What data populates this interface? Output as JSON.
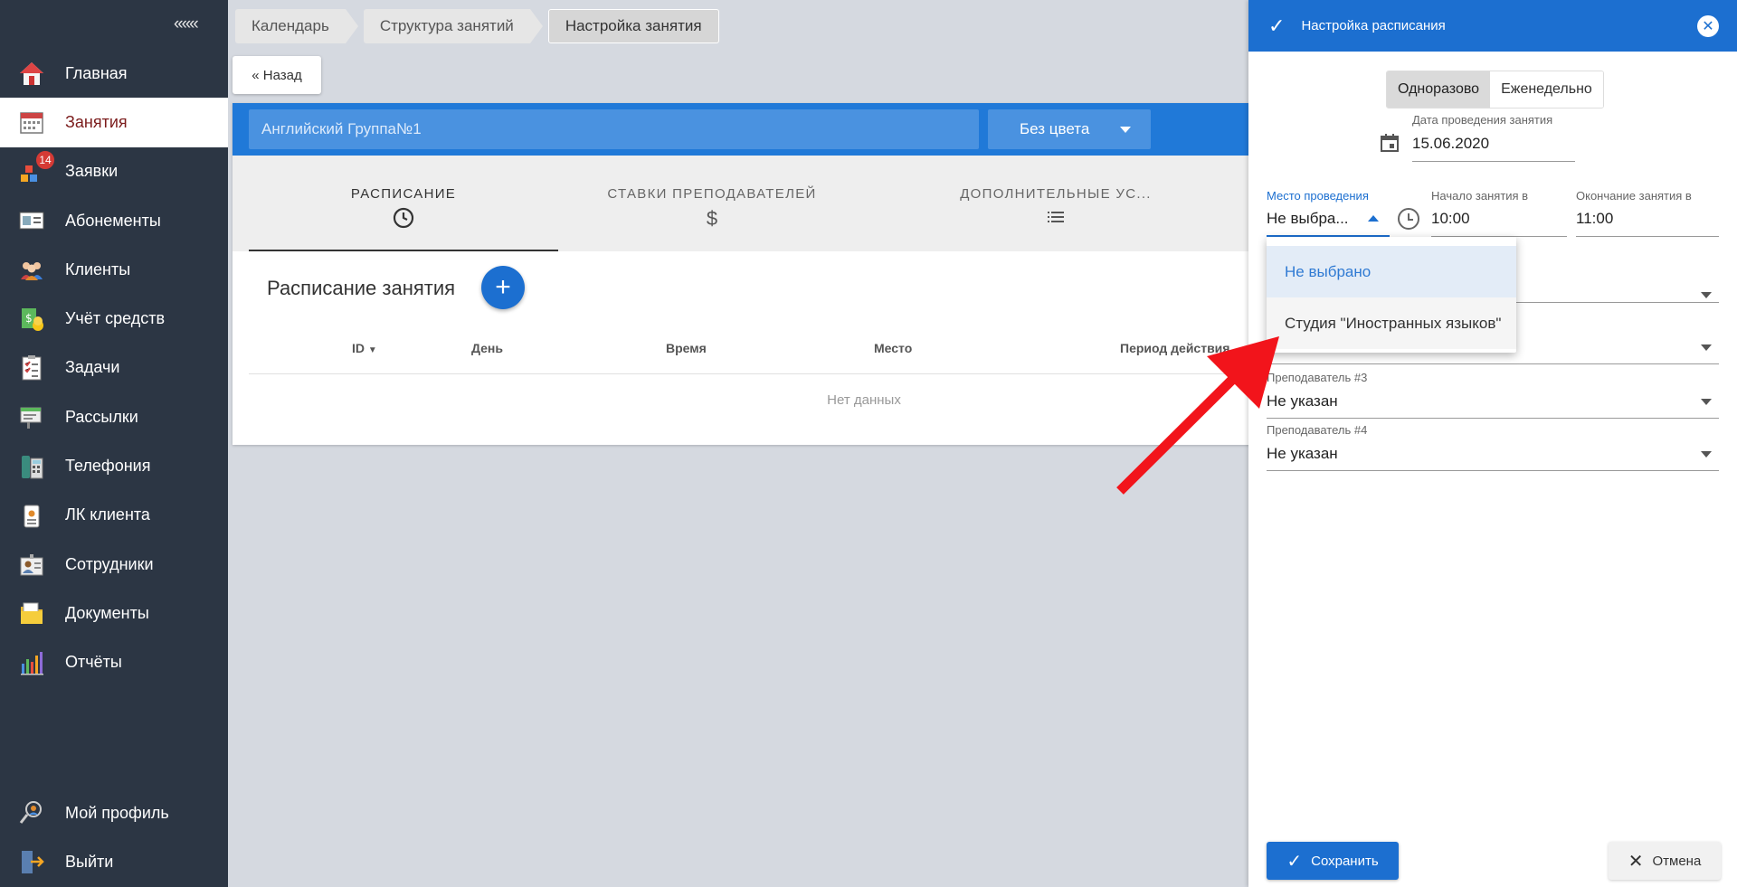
{
  "sidebar": {
    "collapse_label": "«««",
    "items": [
      {
        "label": "Главная",
        "icon": "home-icon"
      },
      {
        "label": "Занятия",
        "icon": "calendar-icon"
      },
      {
        "label": "Заявки",
        "icon": "requests-icon",
        "badge": "14"
      },
      {
        "label": "Абонементы",
        "icon": "membership-card-icon"
      },
      {
        "label": "Клиенты",
        "icon": "clients-icon"
      },
      {
        "label": "Учёт средств",
        "icon": "money-icon"
      },
      {
        "label": "Задачи",
        "icon": "tasks-icon"
      },
      {
        "label": "Рассылки",
        "icon": "mailing-icon"
      },
      {
        "label": "Телефония",
        "icon": "phone-icon"
      },
      {
        "label": "ЛК клиента",
        "icon": "client-cabinet-icon"
      },
      {
        "label": "Сотрудники",
        "icon": "staff-icon"
      },
      {
        "label": "Документы",
        "icon": "documents-icon"
      },
      {
        "label": "Отчёты",
        "icon": "reports-icon"
      }
    ],
    "bottom": [
      {
        "label": "Мой профиль",
        "icon": "profile-icon"
      },
      {
        "label": "Выйти",
        "icon": "logout-icon"
      }
    ]
  },
  "breadcrumbs": [
    "Календарь",
    "Структура занятий",
    "Настройка занятия"
  ],
  "back_label": "« Назад",
  "lesson": {
    "name": "Английский Группа№1",
    "color": "Без цвета",
    "tabs": [
      "РАСПИСАНИЕ",
      "СТАВКИ ПРЕПОДАВАТЕЛЕЙ",
      "ДОПОЛНИТЕЛЬНЫЕ УС..."
    ],
    "section_title": "Расписание занятия",
    "columns": [
      "ID",
      "День",
      "Время",
      "Место",
      "Период действия"
    ],
    "empty_text": "Нет данных"
  },
  "panel": {
    "title": "Настройка расписания",
    "toggle": [
      "Одноразово",
      "Еженедельно"
    ],
    "date_label": "Дата проведения занятия",
    "date_value": "15.06.2020",
    "place_label": "Место проведения",
    "place_value": "Не выбра...",
    "start_label": "Начало занятия в",
    "start_value": "10:00",
    "end_label": "Окончание занятия в",
    "end_value": "11:00",
    "place_options": [
      "Не выбрано",
      "Студия \"Иностранных языков\""
    ],
    "teacher3_label": "Преподаватель #3",
    "teacher3_value": "Не указан",
    "teacher4_label": "Преподаватель #4",
    "teacher4_value": "Не указан",
    "save_label": "Сохранить",
    "cancel_label": "Отмена"
  },
  "colors": {
    "accent": "#1c6fd0",
    "sidebar": "#2c3644",
    "arrow": "#f2141b"
  }
}
